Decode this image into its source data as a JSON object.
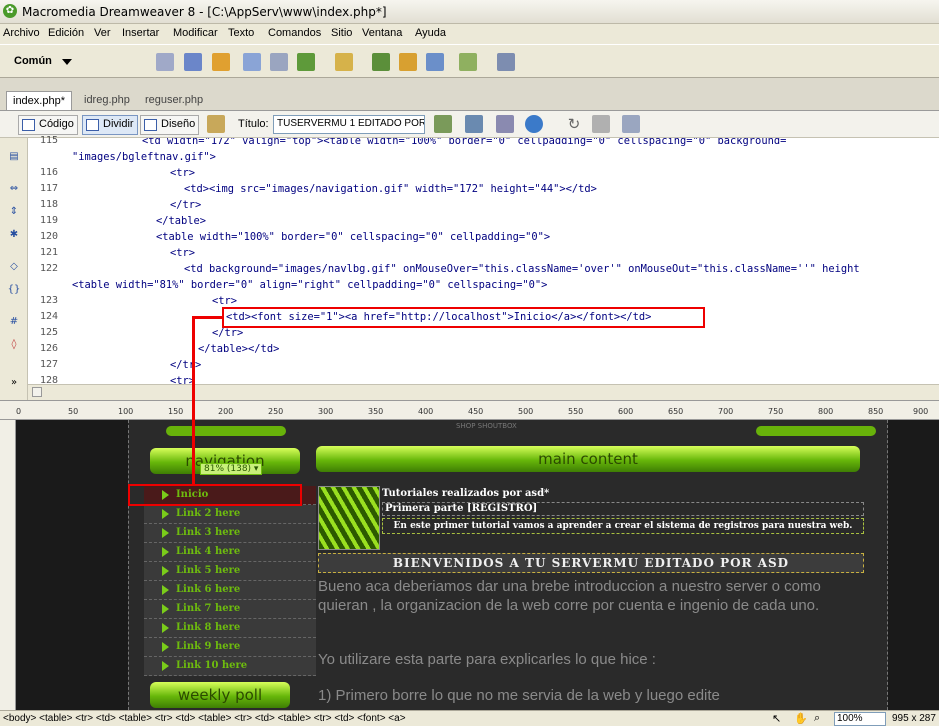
{
  "window": {
    "title": "Macromedia Dreamweaver 8 - [C:\\AppServ\\www\\index.php*]"
  },
  "menu": [
    "Archivo",
    "Edición",
    "Ver",
    "Insertar",
    "Modificar",
    "Texto",
    "Comandos",
    "Sitio",
    "Ventana",
    "Ayuda"
  ],
  "insert_bar": {
    "category": "Común"
  },
  "tabs": [
    "index.php*",
    "idreg.php",
    "reguser.php"
  ],
  "doc_toolbar": {
    "code": "Código",
    "split": "Dividir",
    "design": "Diseño",
    "title_label": "Título:",
    "title_value": "TUSERVERMU 1 EDITADO POR"
  },
  "code_lines": [
    {
      "num": "115",
      "text": "<td width=\"172\" valign=\"top\"><table width=\"100%\" border=\"0\" cellpadding=\"0\" cellspacing=\"0\" background="
    },
    {
      "num": "",
      "text": "\"images/bgleftnav.gif\">"
    },
    {
      "num": "116",
      "text": "<tr>"
    },
    {
      "num": "117",
      "text": "<td><img src=\"images/navigation.gif\" width=\"172\" height=\"44\"></td>"
    },
    {
      "num": "118",
      "text": "</tr>"
    },
    {
      "num": "119",
      "text": "</table>"
    },
    {
      "num": "120",
      "text": "<table width=\"100%\" border=\"0\" cellspacing=\"0\" cellpadding=\"0\">"
    },
    {
      "num": "121",
      "text": "<tr>"
    },
    {
      "num": "122",
      "text": "<td background=\"images/navlbg.gif\" onMouseOver=\"this.className='over'\" onMouseOut=\"this.className=''\" height"
    },
    {
      "num": "",
      "text": "<table width=\"81%\" border=\"0\" align=\"right\" cellpadding=\"0\" cellspacing=\"0\">"
    },
    {
      "num": "123",
      "text": "<tr>"
    },
    {
      "num": "124",
      "text": "<td><font size=\"1\"><a href=\"http://localhost\">Inicio</a></font></td>"
    },
    {
      "num": "125",
      "text": "</tr>"
    },
    {
      "num": "126",
      "text": "</table></td>"
    },
    {
      "num": "127",
      "text": "</tr>"
    },
    {
      "num": "128",
      "text": "<tr>"
    }
  ],
  "ruler_marks": [
    "0",
    "50",
    "100",
    "150",
    "200",
    "250",
    "300",
    "350",
    "400",
    "450",
    "500",
    "550",
    "600",
    "650",
    "700",
    "750",
    "800",
    "850",
    "900"
  ],
  "design": {
    "shop_text": "SHOP SHOUTBOX",
    "nav_header": "navigation",
    "table_width_label": "81% (138) ▾",
    "nav_links": [
      "Inicio",
      "Link 2 here",
      "Link 3 here",
      "Link 4 here",
      "Link 5 here",
      "Link 6 here",
      "Link 7 here",
      "Link 8 here",
      "Link 9 here",
      "Link 10 here"
    ],
    "weekly_poll": "weekly poll",
    "main_content_header": "main content",
    "tutorial_title": "Tutoriales realizados por asd*",
    "tutorial_subtitle": "Primera parte [REGISTRO]",
    "tutorial_desc": "En este primer tutorial vamos a aprender a crear el sistema de registros para nuestra web.",
    "welcome_banner": "BIENVENIDOS A TU SERVERMU EDITADO POR ASD",
    "para1": "Bueno aca deberiamos dar una brebe introduccion a nuestro server o como quieran , la organizacion de la web corre por cuenta e ingenio de cada uno.",
    "para2": "Yo utilizare esta parte para explicarles lo que hice :",
    "para3": "1) Primero borre lo que no me servia de la web y luego edite"
  },
  "status": {
    "tag_path": "<body> <table> <tr> <td> <table> <tr> <td> <table> <tr> <td> <table> <tr> <td> <font> <a>",
    "zoom": "100%",
    "size": "995 x 287"
  },
  "colors": {
    "accent_red": "#e00000",
    "nav_green": "#6ebc0e",
    "code_blue": "#000080"
  }
}
